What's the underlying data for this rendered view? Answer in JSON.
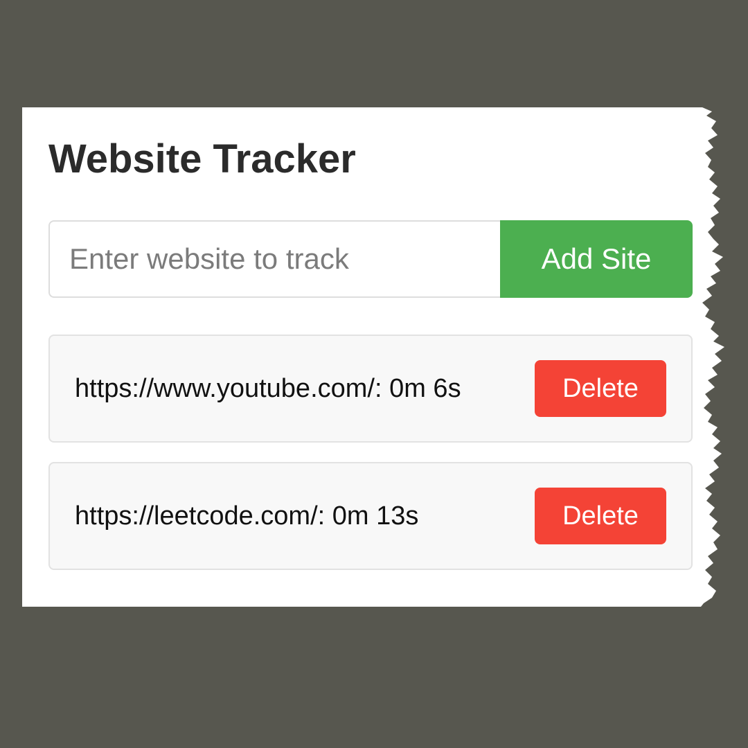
{
  "app": {
    "title": "Website Tracker"
  },
  "form": {
    "input_value": "",
    "placeholder": "Enter website to track",
    "add_label": "Add Site"
  },
  "sites": [
    {
      "entry": "https://www.youtube.com/: 0m 6s",
      "delete_label": "Delete"
    },
    {
      "entry": "https://leetcode.com/: 0m 13s",
      "delete_label": "Delete"
    }
  ],
  "colors": {
    "background": "#57574f",
    "add_button": "#4caf50",
    "delete_button": "#f44336",
    "item_background": "#f8f8f8"
  }
}
